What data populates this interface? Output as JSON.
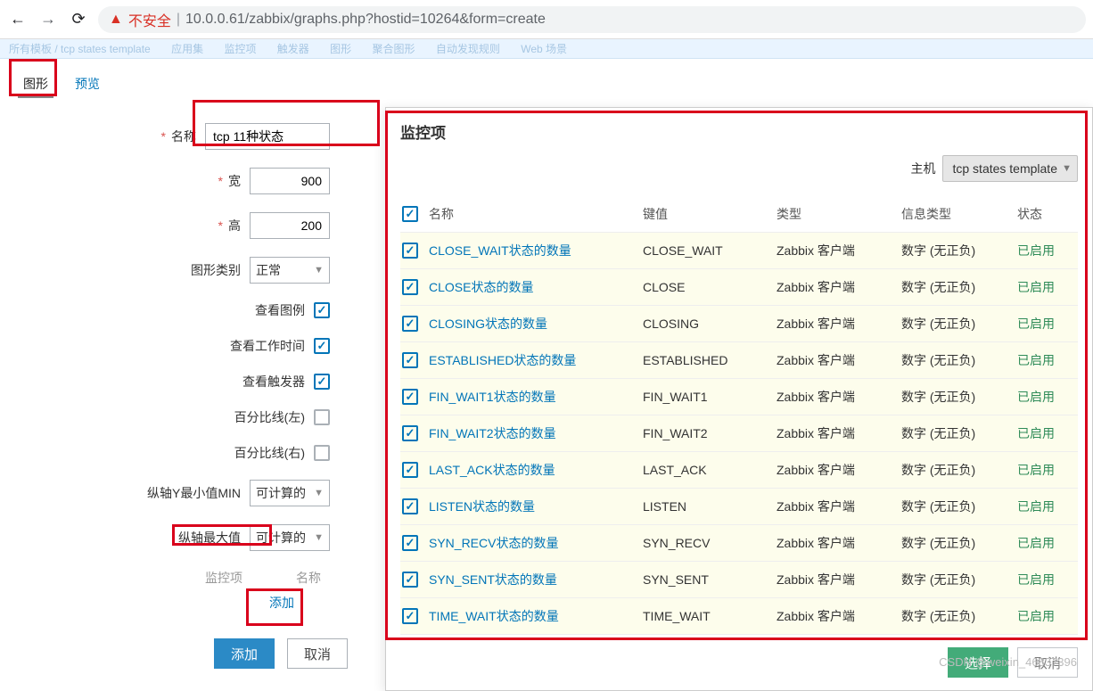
{
  "chrome": {
    "back": "←",
    "forward": "→",
    "reload": "⟳",
    "unsafe": "不安全",
    "url": "10.0.0.61/zabbix/graphs.php?hostid=10264&form=create"
  },
  "topstrip": {
    "a": "所有模板 / tcp states template",
    "b": "应用集",
    "c": "监控项",
    "d": "触发器",
    "e": "图形",
    "f": "聚合图形",
    "g": "自动发现规则",
    "h": "Web 场景"
  },
  "tabs": {
    "t1": "图形",
    "t2": "预览"
  },
  "form": {
    "name_label": "名称",
    "name_value": "tcp 11种状态",
    "width_label": "宽",
    "width_value": "900",
    "height_label": "高",
    "height_value": "200",
    "gtype_label": "图形类别",
    "gtype_value": "正常",
    "legend_label": "查看图例",
    "worktime_label": "查看工作时间",
    "triggers_label": "查看触发器",
    "pct_left_label": "百分比线(左)",
    "pct_right_label": "百分比线(右)",
    "ymin_label": "纵轴Y最小值MIN",
    "ymin_value": "可计算的",
    "ymax_label": "纵轴最大值",
    "ymax_value": "可计算的",
    "section_item": "监控项",
    "section_name": "名称",
    "add_link": "添加",
    "add_btn": "添加",
    "cancel_btn": "取消"
  },
  "panel": {
    "title": "监控项",
    "host_label": "主机",
    "host_value": "tcp states template",
    "cols": {
      "name": "名称",
      "key": "键值",
      "type": "类型",
      "info": "信息类型",
      "status": "状态"
    },
    "type_text": "Zabbix 客户端",
    "info_text": "数字 (无正负)",
    "status_text": "已启用",
    "rows": [
      {
        "name": "CLOSE_WAIT状态的数量",
        "key": "CLOSE_WAIT"
      },
      {
        "name": "CLOSE状态的数量",
        "key": "CLOSE"
      },
      {
        "name": "CLOSING状态的数量",
        "key": "CLOSING"
      },
      {
        "name": "ESTABLISHED状态的数量",
        "key": "ESTABLISHED"
      },
      {
        "name": "FIN_WAIT1状态的数量",
        "key": "FIN_WAIT1"
      },
      {
        "name": "FIN_WAIT2状态的数量",
        "key": "FIN_WAIT2"
      },
      {
        "name": "LAST_ACK状态的数量",
        "key": "LAST_ACK"
      },
      {
        "name": "LISTEN状态的数量",
        "key": "LISTEN"
      },
      {
        "name": "SYN_RECV状态的数量",
        "key": "SYN_RECV"
      },
      {
        "name": "SYN_SENT状态的数量",
        "key": "SYN_SENT"
      },
      {
        "name": "TIME_WAIT状态的数量",
        "key": "TIME_WAIT"
      }
    ],
    "select_btn": "选择",
    "cancel_btn": "取消"
  },
  "watermark": "CSDN @weixin_46837396"
}
